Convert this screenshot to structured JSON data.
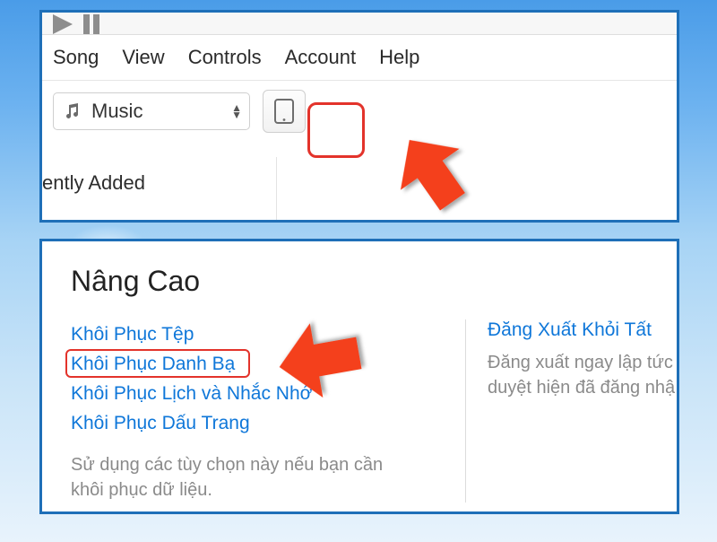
{
  "top": {
    "menu": {
      "song": "Song",
      "view": "View",
      "controls": "Controls",
      "account": "Account",
      "help": "Help"
    },
    "library_select": "Music",
    "sidebar_item": "ently Added"
  },
  "bottom": {
    "title": "Nâng Cao",
    "links": {
      "restore_files": "Khôi Phục Tệp",
      "restore_contacts": "Khôi Phục Danh Bạ",
      "restore_calendar": "Khôi Phục Lịch và Nhắc Nhớ",
      "restore_bookmarks": "Khôi Phục Dấu Trang"
    },
    "left_desc": "Sử dụng các tùy chọn này nếu bạn cần khôi phục dữ liệu.",
    "right_link": "Đăng Xuất Khỏi Tất",
    "right_desc_line1": "Đăng xuất ngay lập tức",
    "right_desc_line2": "duyệt hiện đã đăng nhậ"
  }
}
